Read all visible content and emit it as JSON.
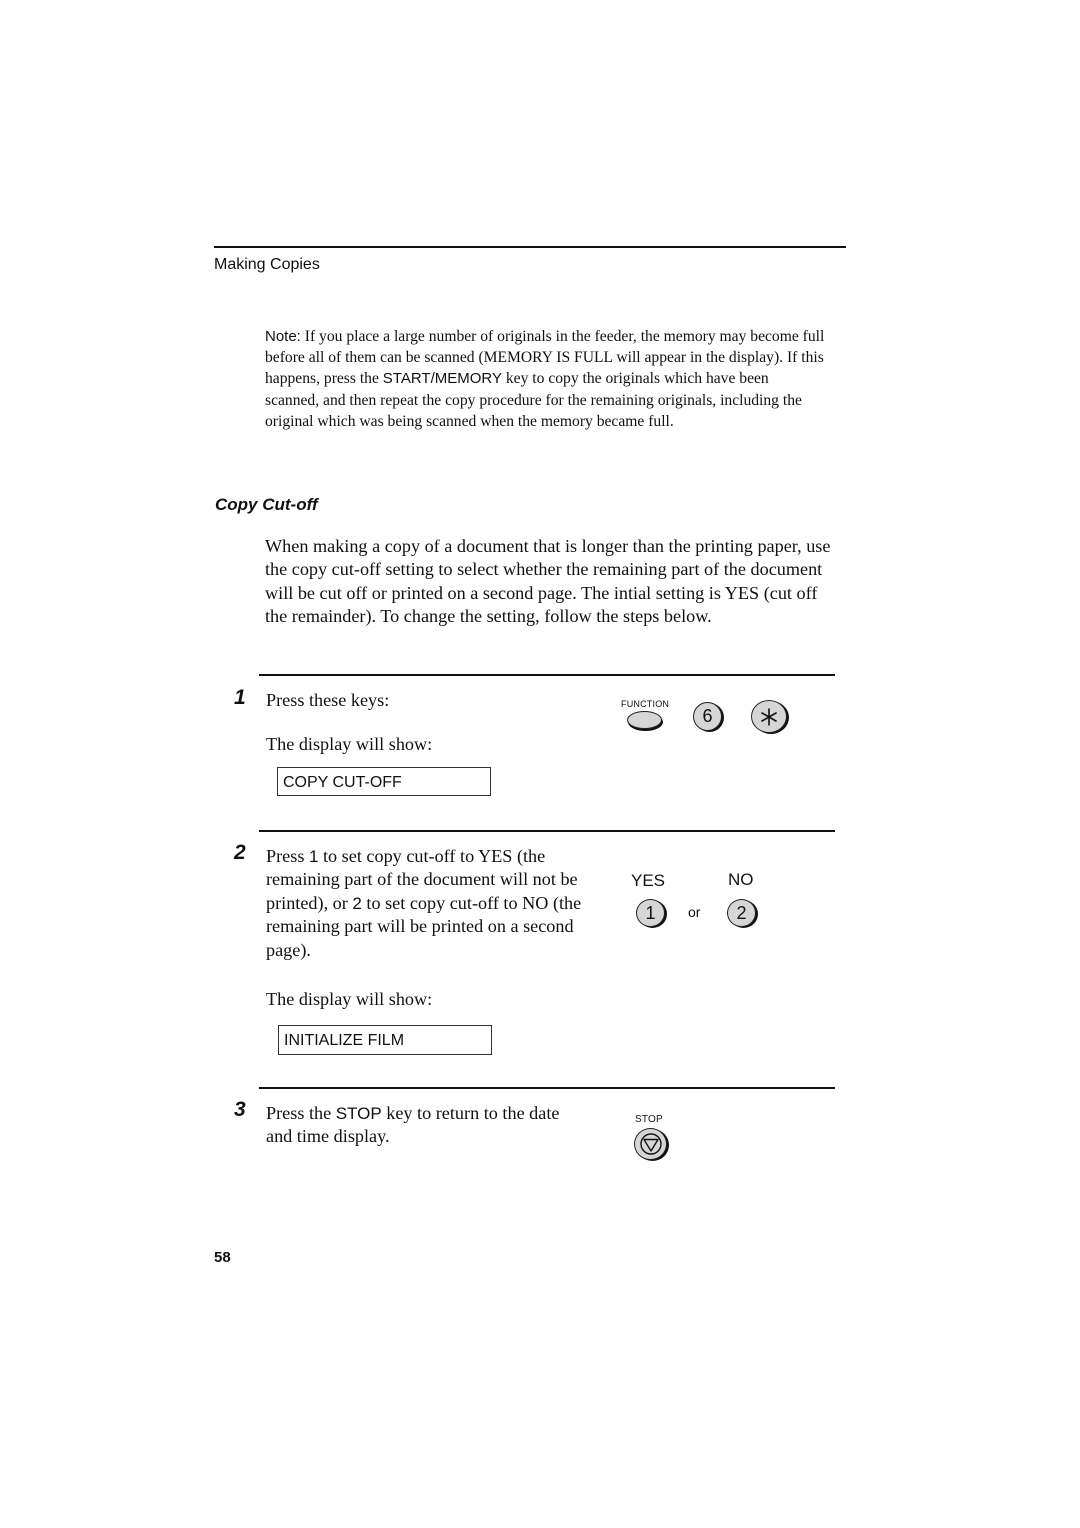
{
  "header": {
    "section": "Making Copies"
  },
  "note": {
    "label": "Note:",
    "text_1": " If you place a large number of originals in the feeder, the memory may become full before all of them can be scanned (MEMORY IS FULL will appear in the display). If this happens, press the ",
    "key": "START/MEMORY",
    "text_2": " key to copy the originals which have been scanned, and then repeat the copy procedure for the remaining originals, including the original which was being scanned when the memory became full."
  },
  "section": {
    "title": "Copy Cut-off",
    "intro": "When making a copy of a document that is longer than the printing paper, use the copy cut-off setting to select whether the remaining part of the document will be cut off or printed on a second page. The intial setting is YES (cut off the remainder). To change the setting, follow the steps below."
  },
  "steps": [
    {
      "number": "1",
      "text": "Press these keys:",
      "display_label": "The display will show:",
      "display": "COPY CUT-OFF",
      "keys": {
        "function_label": "FUNCTION",
        "digit": "6",
        "star_icon": "asterisk-icon"
      }
    },
    {
      "number": "2",
      "text_a": "Press ",
      "key_1": "1",
      "text_b": " to set copy cut-off to YES (the remaining part of the document will not be printed), or ",
      "key_2": "2",
      "text_c": " to set copy cut-off to NO (the remaining part will be printed on a second page).",
      "display_label": "The display will show:",
      "display": "INITIALIZE FILM",
      "keys": {
        "yes_label": "YES",
        "no_label": "NO",
        "yes_key": "1",
        "no_key": "2",
        "or": "or"
      }
    },
    {
      "number": "3",
      "text_a": "Press the ",
      "key": "STOP",
      "text_b": " key to return to the date and time display.",
      "keys": {
        "stop_label": "STOP",
        "stop_icon": "stop-triangle-icon"
      }
    }
  ],
  "footer": {
    "page_number": "58"
  }
}
